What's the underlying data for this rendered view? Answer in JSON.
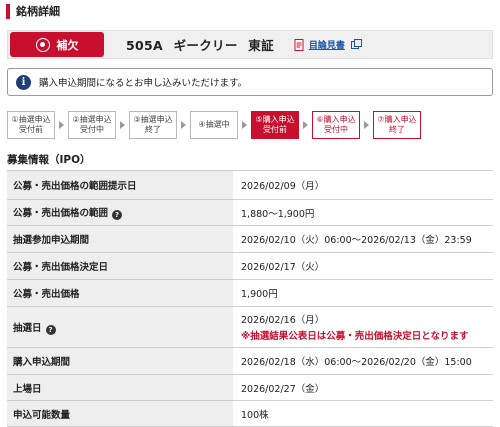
{
  "header": {
    "title": "銘柄詳細"
  },
  "stock": {
    "badge": "補欠",
    "code": "505A",
    "name": "ギークリー",
    "market": "東証",
    "prospectus_link": "目論見書"
  },
  "notice": {
    "icon": "i",
    "text": "購入申込期間になるとお申し込みいただけます。"
  },
  "steps": [
    {
      "label": "①抽選申込\n受付前",
      "state": "past"
    },
    {
      "label": "②抽選申込\n受付中",
      "state": "past"
    },
    {
      "label": "③抽選申込\n終了",
      "state": "past"
    },
    {
      "label": "④抽選中",
      "state": "past"
    },
    {
      "label": "⑤購入申込\n受付前",
      "state": "active"
    },
    {
      "label": "⑥購入申込\n受付中",
      "state": "future"
    },
    {
      "label": "⑦購入申込\n終了",
      "state": "future"
    }
  ],
  "section_title": "募集情報（IPO）",
  "rows": [
    {
      "label": "公募・売出価格の範囲提示日",
      "value": "2026/02/09（月）"
    },
    {
      "label": "公募・売出価格の範囲",
      "value": "1,880～1,900円",
      "help": "?"
    },
    {
      "label": "抽選参加申込期間",
      "value": "2026/02/10（火）06:00～2026/02/13（金）23:59"
    },
    {
      "label": "公募・売出価格決定日",
      "value": "2026/02/17（火）"
    },
    {
      "label": "公募・売出価格",
      "value": "1,900円"
    },
    {
      "label": "抽選日",
      "value": "2026/02/16（月）",
      "help": "?",
      "note": "※抽選結果公表日は公募・売出価格決定日となります"
    },
    {
      "label": "購入申込期間",
      "value": "2026/02/18（水）06:00～2026/02/20（金）15:00"
    },
    {
      "label": "上場日",
      "value": "2026/02/27（金）"
    },
    {
      "label": "申込可能数量",
      "value": "100株"
    }
  ],
  "colors": {
    "accent": "#c8102e",
    "info": "#1c3f7a",
    "link": "#1a55a6",
    "label_bg": "#eeeeee"
  }
}
